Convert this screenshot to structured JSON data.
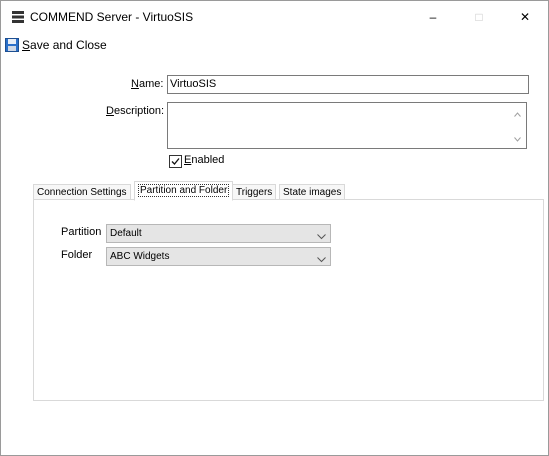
{
  "window": {
    "title": "COMMEND Server  -  VirtuoSIS",
    "buttons": {
      "minimize": "–",
      "maximize": "□",
      "close": "✕"
    }
  },
  "toolbar": {
    "save_label_access_key": "S",
    "save_label_rest": "ave and Close"
  },
  "form": {
    "name_label_access_key": "N",
    "name_label_rest": "ame:",
    "name_value": "VirtuoSIS",
    "description_label_access_key": "D",
    "description_label_rest": "escription:",
    "description_value": "",
    "enabled_checked": true,
    "enabled_label_access_key": "E",
    "enabled_label_rest": "nabled"
  },
  "tabs": [
    {
      "label": "Connection Settings",
      "active": false
    },
    {
      "label": "Partition and Folder",
      "active": true
    },
    {
      "label": "Triggers",
      "active": false
    },
    {
      "label": "State images",
      "active": false
    }
  ],
  "partition_folder": {
    "partition_label": "Partition",
    "partition_value": "Default",
    "folder_label": "Folder",
    "folder_value": "ABC Widgets"
  },
  "icons": {
    "app": "server-icon",
    "save": "floppy-disk-icon",
    "dropdown": "chevron-down-icon",
    "scroll_up": "scroll-up-arrow-icon",
    "scroll_down": "scroll-down-arrow-icon",
    "check": "checkmark-icon"
  }
}
